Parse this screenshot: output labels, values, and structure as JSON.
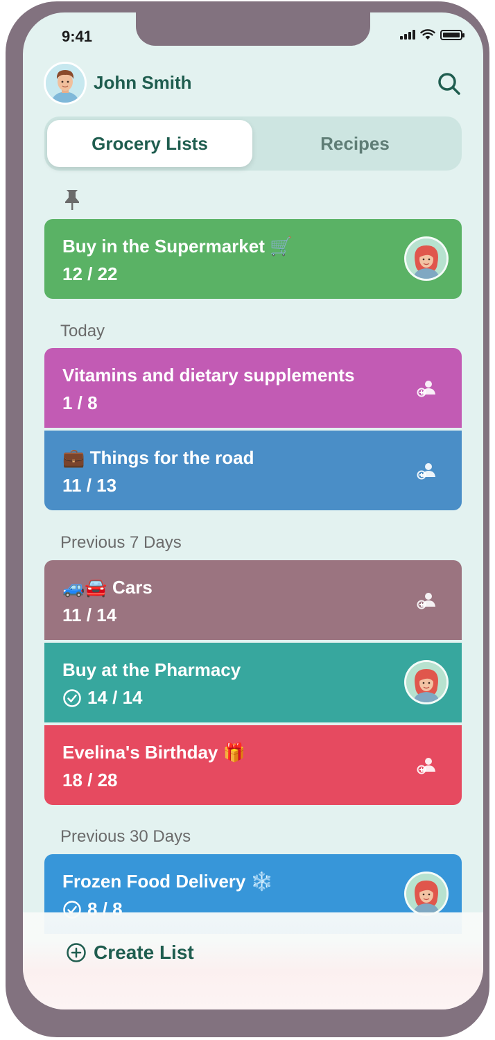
{
  "status_bar": {
    "time": "9:41",
    "icons": [
      "cellular-signal-icon",
      "wifi-icon",
      "battery-icon"
    ]
  },
  "header": {
    "user_name": "John Smith",
    "avatar": "user-avatar-male",
    "search_icon": "search-icon"
  },
  "tabs": [
    {
      "label": "Grocery Lists",
      "active": true
    },
    {
      "label": "Recipes",
      "active": false
    }
  ],
  "pinned": {
    "icon": "pin-icon",
    "lists": [
      {
        "title": "Buy in the Supermarket 🛒",
        "count": "12 / 22",
        "color": "#5ab265",
        "member": "avatar"
      }
    ]
  },
  "sections": [
    {
      "label": "Today",
      "lists": [
        {
          "title": "Vitamins and dietary supplements",
          "count": "1 / 8",
          "color": "#c25bb4",
          "member": "add-person-icon"
        },
        {
          "title": "💼 Things for the road",
          "count": "11 / 13",
          "color": "#4a8ec7",
          "member": "add-person-icon"
        }
      ]
    },
    {
      "label": "Previous 7 Days",
      "lists": [
        {
          "title": "🚙🚘 Cars",
          "count": "11 / 14",
          "color": "#9b7480",
          "member": "add-person-icon"
        },
        {
          "title": "Buy at the Pharmacy",
          "count": "14 / 14",
          "completed": true,
          "color": "#37a79e",
          "member": "avatar"
        },
        {
          "title": "Evelina's Birthday 🎁",
          "count": "18 / 28",
          "color": "#e64a60",
          "member": "add-person-icon"
        }
      ]
    },
    {
      "label": "Previous 30 Days",
      "lists": [
        {
          "title": "Frozen Food Delivery ❄️",
          "count": "8 / 8",
          "completed": true,
          "color": "#3796d9",
          "member": "avatar"
        }
      ]
    }
  ],
  "footer": {
    "create_label": "Create List",
    "icon": "plus-circle-icon"
  }
}
